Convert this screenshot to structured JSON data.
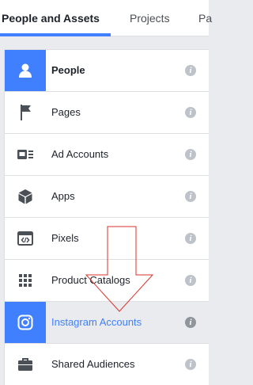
{
  "tabs": [
    {
      "label": "People and Assets",
      "active": true
    },
    {
      "label": "Projects",
      "active": false
    },
    {
      "label": "Pa",
      "active": false
    }
  ],
  "items": [
    {
      "label": "People",
      "icon": "person-icon",
      "selected": false
    },
    {
      "label": "Pages",
      "icon": "flag-icon",
      "selected": false
    },
    {
      "label": "Ad Accounts",
      "icon": "ad-account-icon",
      "selected": false
    },
    {
      "label": "Apps",
      "icon": "cube-icon",
      "selected": false
    },
    {
      "label": "Pixels",
      "icon": "code-window-icon",
      "selected": false
    },
    {
      "label": "Product Catalogs",
      "icon": "grid-icon",
      "selected": false
    },
    {
      "label": "Instagram Accounts",
      "icon": "instagram-icon",
      "selected": true
    },
    {
      "label": "Shared Audiences",
      "icon": "briefcase-icon",
      "selected": false
    }
  ],
  "info_glyph": "i",
  "colors": {
    "accent": "#4080ff",
    "annotation_arrow": "#d9332b",
    "info": "#bec2c9"
  }
}
